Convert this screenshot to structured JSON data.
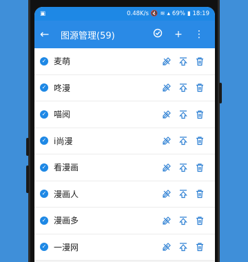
{
  "status": {
    "speed": "0.48K/s",
    "battery": "69%",
    "time": "18:19"
  },
  "appbar": {
    "title": "图源管理(59)"
  },
  "sources": [
    {
      "name": "麦萌"
    },
    {
      "name": "咚漫"
    },
    {
      "name": "喵阅"
    },
    {
      "name": "i尚漫"
    },
    {
      "name": "看漫画"
    },
    {
      "name": "漫画人"
    },
    {
      "name": "漫画多"
    },
    {
      "name": "一漫网"
    }
  ],
  "colors": {
    "primary": "#2a8ae6",
    "background": "#3f8fd9"
  }
}
